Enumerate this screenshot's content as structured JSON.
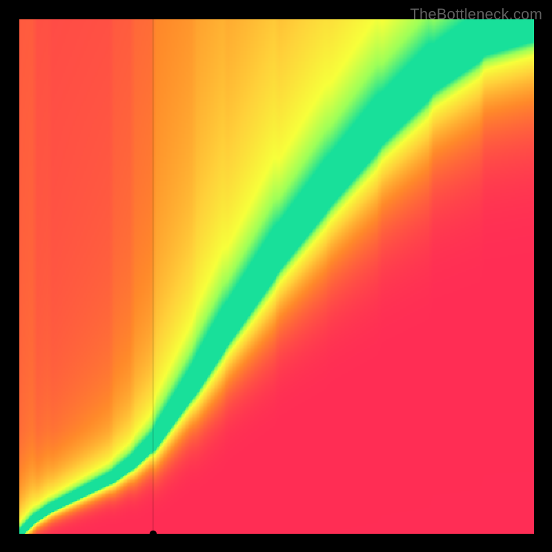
{
  "attribution": "TheBottleneck.com",
  "chart_data": {
    "type": "heatmap",
    "title": "",
    "xlabel": "",
    "ylabel": "",
    "xlim": [
      0,
      100
    ],
    "ylim": [
      0,
      100
    ],
    "grid": false,
    "legend": false,
    "colormap_stops": [
      {
        "t": 0.0,
        "color": "#ff2d55"
      },
      {
        "t": 0.35,
        "color": "#ff8a2a"
      },
      {
        "t": 0.6,
        "color": "#ffd23a"
      },
      {
        "t": 0.78,
        "color": "#f7ff3a"
      },
      {
        "t": 0.9,
        "color": "#9cff5a"
      },
      {
        "t": 1.0,
        "color": "#18e09a"
      }
    ],
    "ridge_points_xy": [
      [
        0,
        0
      ],
      [
        3,
        3
      ],
      [
        6,
        5
      ],
      [
        10,
        7
      ],
      [
        14,
        9
      ],
      [
        18,
        11
      ],
      [
        22,
        14
      ],
      [
        26,
        18
      ],
      [
        30,
        24
      ],
      [
        34,
        30
      ],
      [
        40,
        40
      ],
      [
        50,
        55
      ],
      [
        60,
        68
      ],
      [
        70,
        80
      ],
      [
        80,
        90
      ],
      [
        90,
        97
      ],
      [
        100,
        100
      ]
    ],
    "ridge_halfwidth_y": [
      [
        0,
        0.6
      ],
      [
        20,
        1.4
      ],
      [
        40,
        2.4
      ],
      [
        60,
        3.0
      ],
      [
        80,
        3.6
      ],
      [
        100,
        4.2
      ]
    ],
    "yellow_falloff_scale_y": [
      [
        0,
        3
      ],
      [
        20,
        8
      ],
      [
        50,
        18
      ],
      [
        80,
        28
      ],
      [
        100,
        34
      ]
    ],
    "marker": {
      "x": 26,
      "y": 0
    },
    "axis_crosshair": {
      "x": 26,
      "y_top": 100,
      "y_bottom": 0
    }
  }
}
